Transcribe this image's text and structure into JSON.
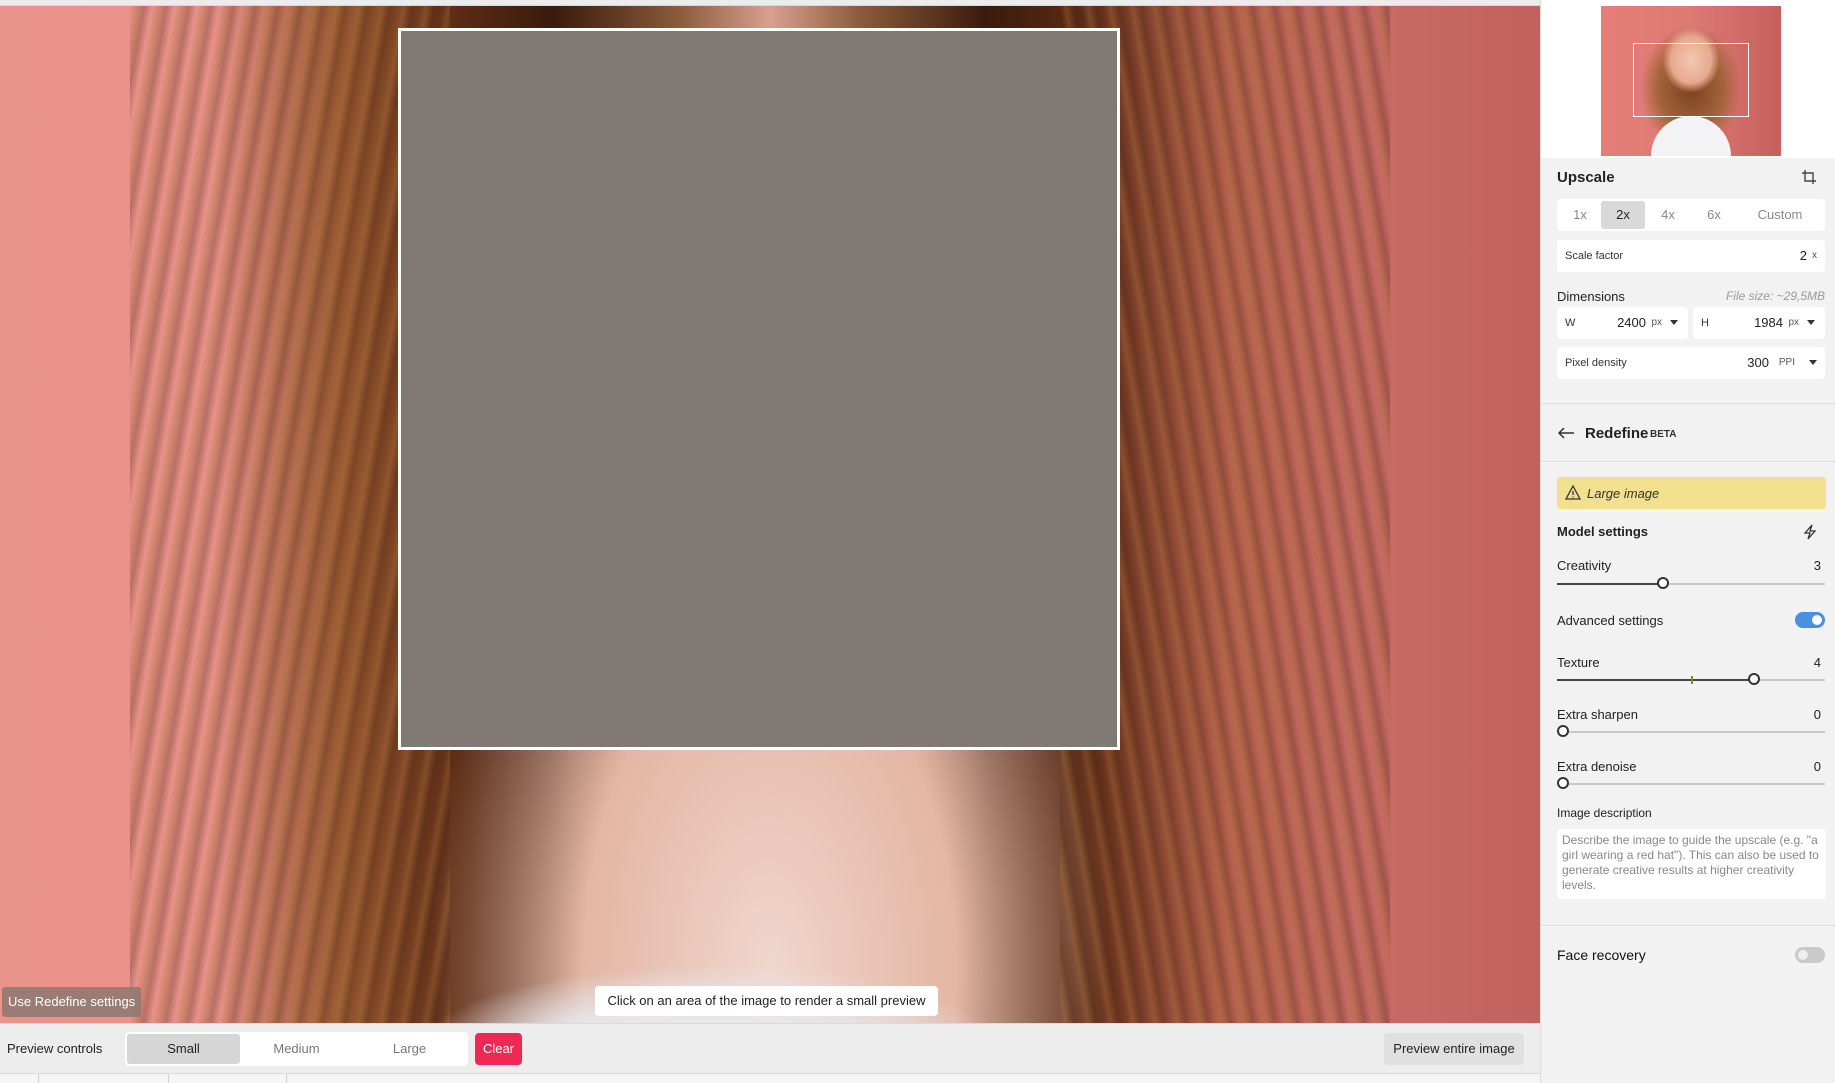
{
  "canvas": {
    "redefine_chip": "Use Redefine settings",
    "hint": "Click on an area of the image to render a small preview"
  },
  "bottom": {
    "preview_controls_label": "Preview controls",
    "sizes": [
      "Small",
      "Medium",
      "Large"
    ],
    "selected_size": "Small",
    "clear_label": "Clear",
    "preview_entire_label": "Preview entire image"
  },
  "upscale": {
    "title": "Upscale",
    "scale_options": [
      "1x",
      "2x",
      "4x",
      "6x",
      "Custom"
    ],
    "selected_scale": "2x",
    "scale_factor_label": "Scale factor",
    "scale_factor_value": "2",
    "scale_factor_unit": "x",
    "dimensions_label": "Dimensions",
    "file_size": "File size: ~29,5MB",
    "width_label": "W",
    "width_value": "2400",
    "width_unit": "px",
    "height_label": "H",
    "height_value": "1984",
    "height_unit": "px",
    "pixel_density_label": "Pixel density",
    "pixel_density_value": "300",
    "pixel_density_unit": "PPI"
  },
  "redefine": {
    "title": "Redefine",
    "badge": "BETA",
    "warning": "Large image",
    "model_settings_label": "Model settings",
    "creativity_label": "Creativity",
    "creativity_value": "3",
    "creativity_fraction": 0.4,
    "advanced_label": "Advanced settings",
    "advanced_on": true,
    "texture_label": "Texture",
    "texture_value": "4",
    "texture_fraction": 0.74,
    "extra_sharpen_label": "Extra sharpen",
    "extra_sharpen_value": "0",
    "extra_denoise_label": "Extra denoise",
    "extra_denoise_value": "0",
    "image_description_label": "Image description",
    "image_description_placeholder": "Describe the image to guide the upscale (e.g. \"a girl wearing a red hat\"). This can also be used to generate creative results at higher creativity levels."
  },
  "face_recovery": {
    "label": "Face recovery",
    "on": false
  },
  "colors": {
    "accent": "#4a90e2",
    "clear": "#ef2855",
    "warning_bg": "#f3e08f"
  }
}
